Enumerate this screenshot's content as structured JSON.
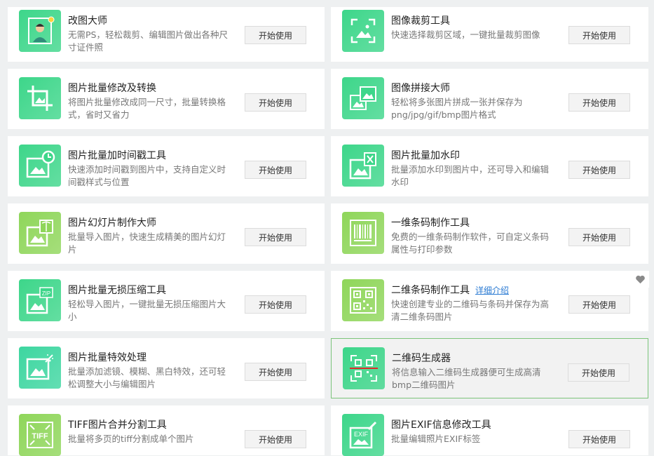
{
  "tools": [
    {
      "title": "改图大师",
      "desc": "无需PS，轻松裁剪、编辑图片做出各种尺寸证件照",
      "button": "开始使用",
      "icon": "person-photo-icon",
      "color": "#3dd68a"
    },
    {
      "title": "图像裁剪工具",
      "desc": "快速选择裁剪区域，一键批量裁剪图像",
      "button": "开始使用",
      "icon": "crop-frame-icon",
      "color": "#3dd68a"
    },
    {
      "title": "图片批量修改及转换",
      "desc": "将图片批量修改成同一尺寸，批量转换格式，省时又省力",
      "button": "开始使用",
      "icon": "crop-tool-icon",
      "color": "#3dd68a"
    },
    {
      "title": "图像拼接大师",
      "desc": "轻松将多张图片拼成一张并保存为png/jpg/gif/bmp图片格式",
      "button": "开始使用",
      "icon": "image-stitch-icon",
      "color": "#3dd68a"
    },
    {
      "title": "图片批量加时间戳工具",
      "desc": "快速添加时间戳到图片中，支持自定义时间戳样式与位置",
      "button": "开始使用",
      "icon": "image-clock-icon",
      "color": "#3dd68a"
    },
    {
      "title": "图片批量加水印",
      "desc": "批量添加水印到图片中，还可导入和编辑水印",
      "button": "开始使用",
      "icon": "image-watermark-icon",
      "color": "#3dd68a"
    },
    {
      "title": "图片幻灯片制作大师",
      "desc": "批量导入图片，快速生成精美的图片幻灯片",
      "button": "开始使用",
      "icon": "image-slideshow-icon",
      "color": "#8fd65a"
    },
    {
      "title": "一维条码制作工具",
      "desc": "免费的一维条码制作软件，可自定义条码属性与打印参数",
      "button": "开始使用",
      "icon": "barcode-icon",
      "color": "#8fd65a"
    },
    {
      "title": "图片批量无损压缩工具",
      "desc": "轻松导入图片，一键批量无损压缩图片大小",
      "button": "开始使用",
      "icon": "image-zip-icon",
      "color": "#3dd68a"
    },
    {
      "title": "二维条码制作工具",
      "desc": "快速创建专业的二维码与条码并保存为高清二维条码图片",
      "button": "开始使用",
      "icon": "qrcode-icon",
      "color": "#8fd65a",
      "link": "详细介绍"
    },
    {
      "title": "图片批量特效处理",
      "desc": "批量添加滤镜、模糊、黑白特效，还可轻松调整大小与编辑图片",
      "button": "开始使用",
      "icon": "image-sparkle-icon",
      "color": "#3dd6a0"
    },
    {
      "title": "二维码生成器",
      "desc": "将信息输入二维码生成器便可生成高清bmp二维码图片",
      "button": "开始使用",
      "icon": "qrcode-scan-icon",
      "color": "#3dd68a"
    },
    {
      "title": "TIFF图片合并分割工具",
      "desc": "批量将多页的tiff分割成单个图片",
      "button": "开始使用",
      "icon": "tiff-icon",
      "color": "#8fd65a"
    },
    {
      "title": "图片EXIF信息修改工具",
      "desc": "批量编辑照片EXIF标签",
      "button": "开始使用",
      "icon": "exif-edit-icon",
      "color": "#3dd68a"
    }
  ],
  "favorite_icon": "heart-icon",
  "highlight_index": 11
}
